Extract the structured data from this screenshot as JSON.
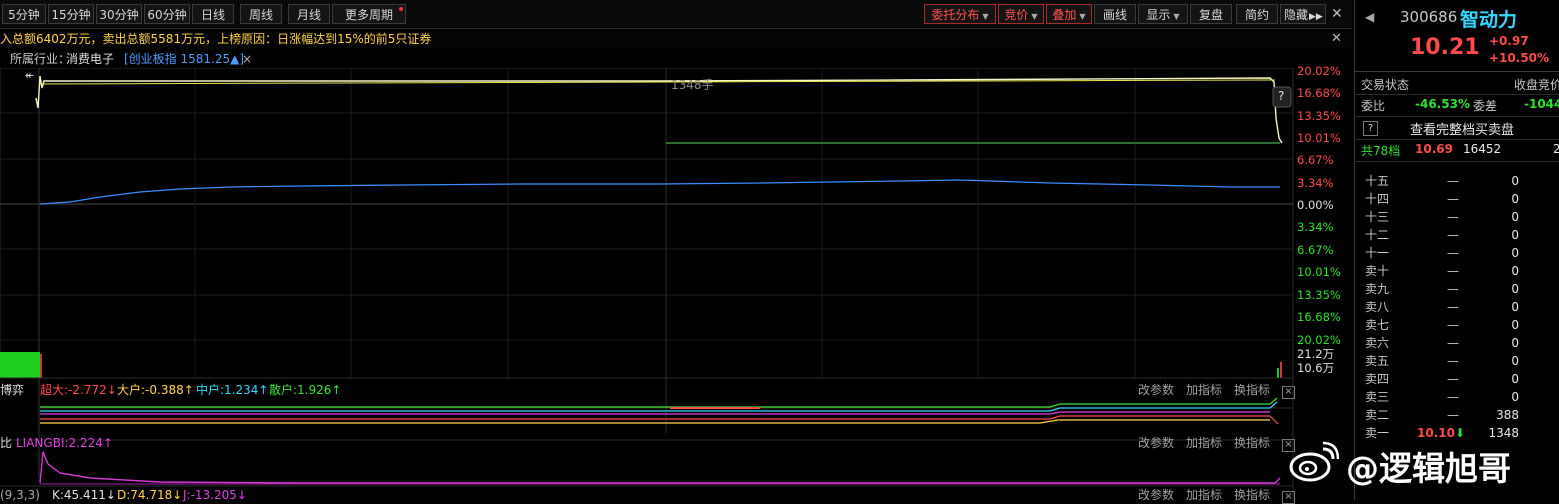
{
  "toolbar": {
    "periods": [
      "5分钟",
      "15分钟",
      "30分钟",
      "60分钟",
      "日线",
      "周线",
      "月线",
      "更多周期"
    ],
    "red_buttons": [
      "委托分布",
      "竞价",
      "叠加"
    ],
    "tools": [
      "画线",
      "显示",
      "复盘",
      "简约",
      "隐藏"
    ]
  },
  "notice": "入总额6402万元，卖出总额5581万元，上榜原因：日涨幅达到15%的前5只证券",
  "industry": {
    "label": "所属行业：",
    "value": "消费电子",
    "index_name": "[创业板指",
    "index_value": "1581.25",
    "index_arrow": "▲]"
  },
  "chart": {
    "price_ticks_up": [
      "20.02%",
      "16.68%",
      "13.35%",
      "10.01%",
      "6.67%",
      "3.34%"
    ],
    "zero_tick": "0.00%",
    "price_ticks_down": [
      "3.34%",
      "6.67%",
      "10.01%",
      "13.35%",
      "16.68%",
      "20.02%"
    ],
    "volume_marker": "1348手",
    "volume_ticks": [
      "21.2万",
      "10.6万"
    ],
    "help_icon": "?"
  },
  "panel1": {
    "name": "博弈",
    "items": [
      {
        "label": "超大:",
        "value": "-2.772",
        "arrow": "↓",
        "color": "#ff4b4b"
      },
      {
        "label": "大户:",
        "value": "-0.388",
        "arrow": "↑",
        "color": "#ffd54a"
      },
      {
        "label": "中户:",
        "value": "1.234",
        "arrow": "↑",
        "color": "#34d7ff"
      },
      {
        "label": "散户:",
        "value": "1.926",
        "arrow": "↑",
        "color": "#37e637"
      }
    ]
  },
  "panel2": {
    "prefix": "比",
    "name": "LIANGBI:2.224",
    "arrow": "↑"
  },
  "panel3": {
    "params": "(9,3,3)",
    "k": "K:45.411",
    "k_arrow": "↓",
    "d": "D:74.718",
    "d_arrow": "↓",
    "j": "J:-13.205",
    "j_arrow": "↓"
  },
  "panel_buttons": [
    "改参数",
    "加指标",
    "换指标"
  ],
  "side": {
    "code": "300686",
    "name": "智动力",
    "price": "10.21",
    "change": "+0.97",
    "change_pct": "+10.50%",
    "status_label": "交易状态",
    "status_value": "收盘竞价",
    "ratio_label": "委比",
    "ratio_value": "-46.53%",
    "diff_label": "委差",
    "diff_value": "-1044",
    "full_depth": "查看完整档买卖盘",
    "levels_label": "共78档",
    "levels_price": "10.69",
    "levels_vol": "16452",
    "levels_extra": "2",
    "rows": [
      {
        "label": "十五",
        "price": "—",
        "vol": "0"
      },
      {
        "label": "十四",
        "price": "—",
        "vol": "0"
      },
      {
        "label": "十三",
        "price": "—",
        "vol": "0"
      },
      {
        "label": "十二",
        "price": "—",
        "vol": "0"
      },
      {
        "label": "十一",
        "price": "—",
        "vol": "0"
      },
      {
        "label": "卖十",
        "price": "—",
        "vol": "0"
      },
      {
        "label": "卖九",
        "price": "—",
        "vol": "0"
      },
      {
        "label": "卖八",
        "price": "—",
        "vol": "0"
      },
      {
        "label": "卖七",
        "price": "—",
        "vol": "0"
      },
      {
        "label": "卖六",
        "price": "—",
        "vol": "0"
      },
      {
        "label": "卖五",
        "price": "—",
        "vol": "0"
      },
      {
        "label": "卖四",
        "price": "—",
        "vol": "0"
      },
      {
        "label": "卖三",
        "price": "—",
        "vol": "0"
      },
      {
        "label": "卖二",
        "price": "—",
        "vol": "388"
      }
    ],
    "sell1_label": "卖一",
    "sell1_price": "10.10",
    "sell1_vol": "1348"
  },
  "watermark": "@逻辑旭哥",
  "colors": {
    "accent_red": "#ff4b4b",
    "accent_green": "#2ee02e",
    "price_line": "#f0f0a0",
    "avg_line": "#3a8cff"
  }
}
